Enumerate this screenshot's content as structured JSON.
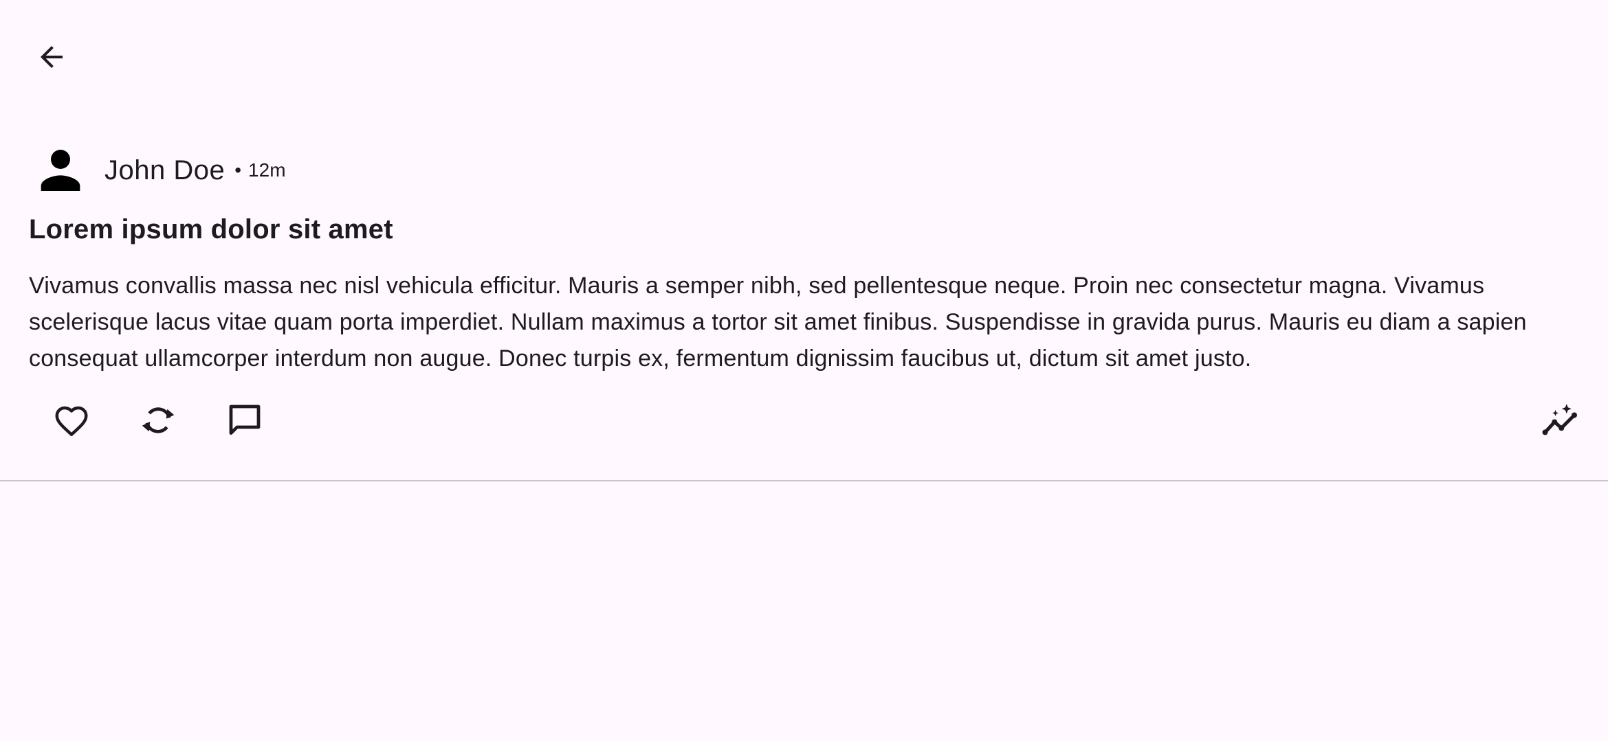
{
  "nav": {
    "back_icon": "arrow-back-icon"
  },
  "post": {
    "author": {
      "name": "John Doe",
      "separator": "•",
      "time": "12m",
      "avatar_icon": "person-icon"
    },
    "title": "Lorem ipsum dolor sit amet",
    "body": "Vivamus convallis massa nec nisl vehicula efficitur. Mauris a semper nibh, sed pellentesque neque. Proin nec consectetur magna. Vivamus scelerisque lacus vitae quam porta imperdiet. Nullam maximus a tortor sit amet finibus. Suspendisse in gravida purus. Mauris eu diam a sapien consequat ullamcorper interdum non augue. Donec turpis ex, fermentum dignissim faucibus ut, dictum sit amet justo.",
    "actions": {
      "like_icon": "heart-outline-icon",
      "repost_icon": "repost-icon",
      "comment_icon": "comment-icon",
      "analytics_icon": "insights-icon"
    }
  },
  "colors": {
    "background": "#FFF8FE",
    "text": "#1D1B20",
    "divider": "#CAC4D0"
  }
}
